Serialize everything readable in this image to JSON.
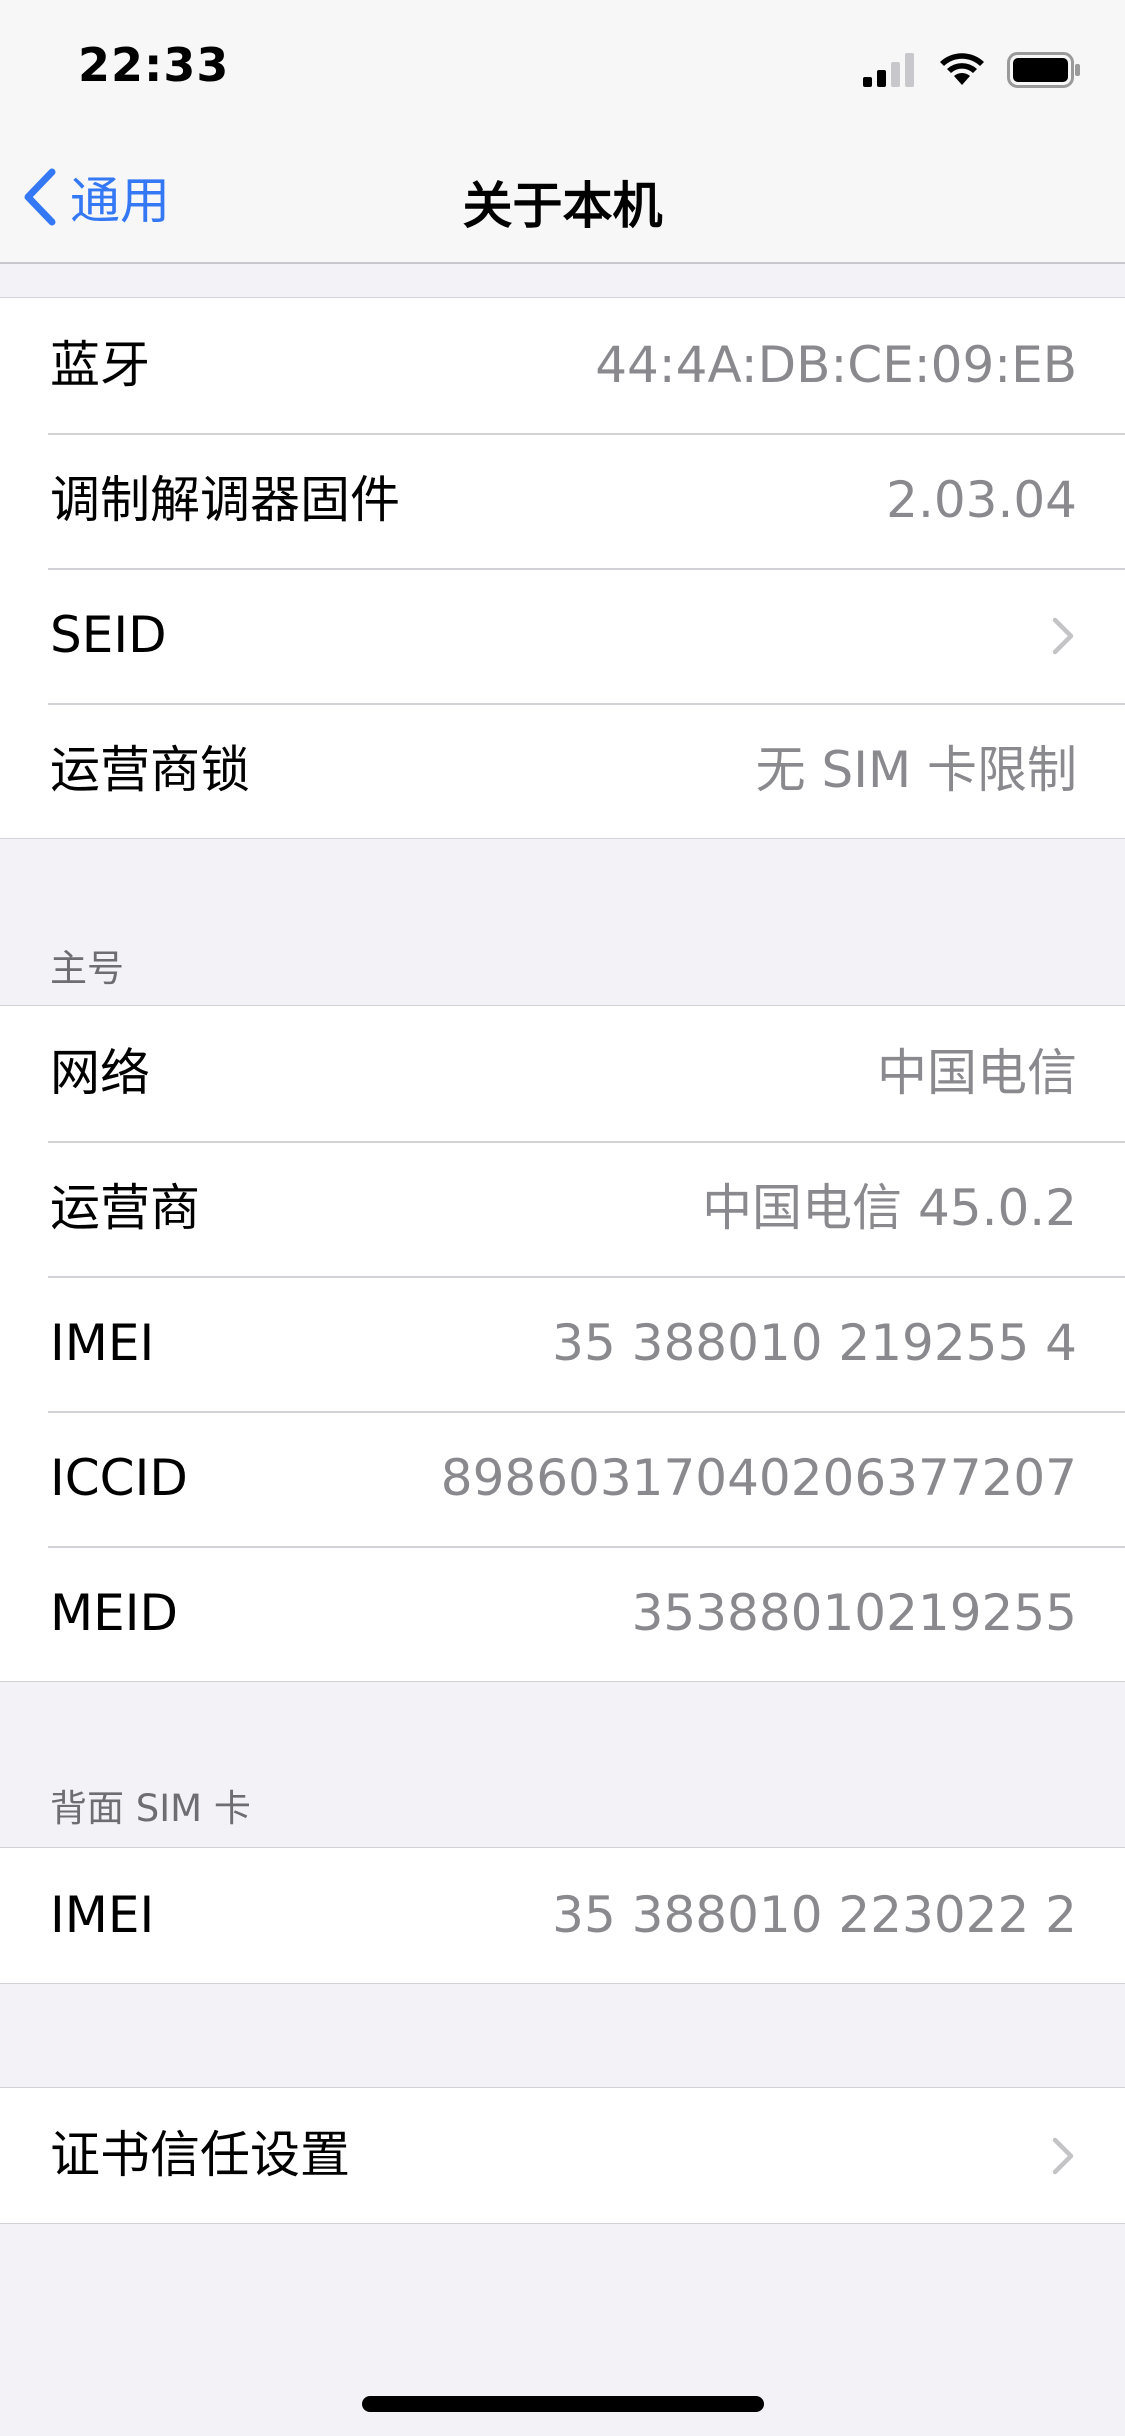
{
  "status_bar": {
    "time": "22:33",
    "icons": [
      "cellular-signal-icon",
      "wifi-icon",
      "battery-icon"
    ]
  },
  "nav": {
    "back_label": "通用",
    "title": "关于本机"
  },
  "top_group": {
    "rows": [
      {
        "label": "蓝牙",
        "value": "44:4A:DB:CE:09:EB"
      },
      {
        "label": "调制解调器固件",
        "value": "2.03.04"
      },
      {
        "label": "SEID",
        "value": ""
      },
      {
        "label": "运营商锁",
        "value": "无 SIM 卡限制"
      }
    ]
  },
  "primary_section": {
    "header": "主号",
    "rows": [
      {
        "label": "网络",
        "value": "中国电信"
      },
      {
        "label": "运营商",
        "value": "中国电信 45.0.2"
      },
      {
        "label": "IMEI",
        "value": "35 388010 219255 4"
      },
      {
        "label": "ICCID",
        "value": "89860317040206377207"
      },
      {
        "label": "MEID",
        "value": "35388010219255"
      }
    ]
  },
  "back_sim_section": {
    "header": "背面 SIM 卡",
    "rows": [
      {
        "label": "IMEI",
        "value": "35 388010 223022 2"
      }
    ]
  },
  "certificate_group": {
    "rows": [
      {
        "label": "证书信任设置",
        "value": ""
      }
    ]
  },
  "colors": {
    "accent": "#3478f6",
    "background": "#f2f2f7",
    "secondary_text": "#8a8a8e"
  }
}
